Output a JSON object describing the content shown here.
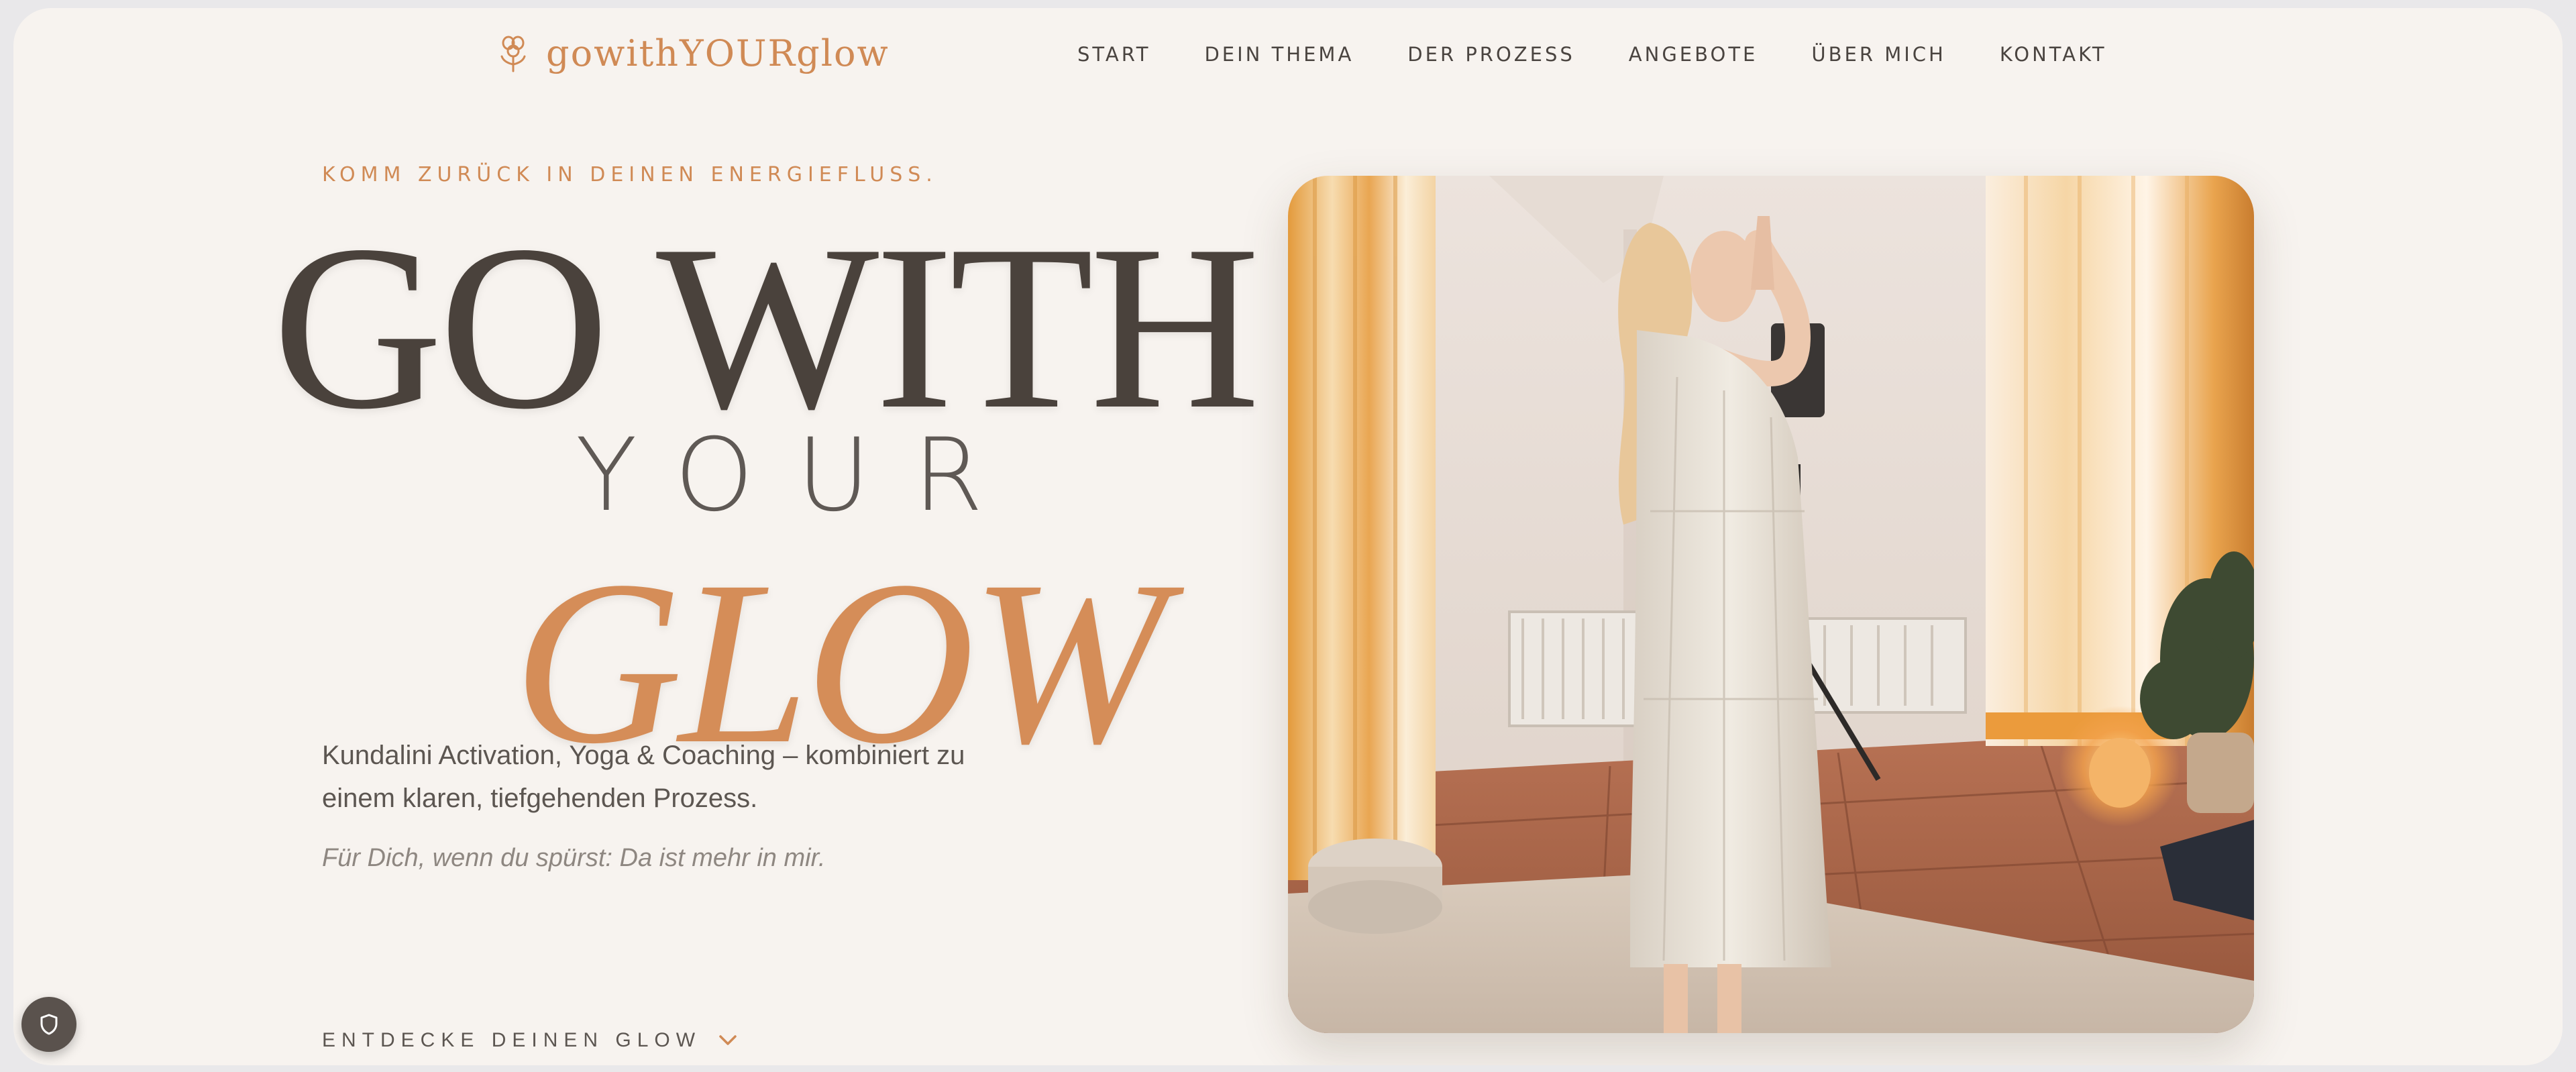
{
  "brand": {
    "name": "gowithYOURglow",
    "accent": "#d08a55",
    "dark": "#4a423c"
  },
  "nav": {
    "items": [
      "START",
      "DEIN THEMA",
      "DER PROZESS",
      "ANGEBOTE",
      "ÜBER MICH",
      "KONTAKT"
    ]
  },
  "hero": {
    "eyebrow": "KOMM ZURÜCK IN DEINEN ENERGIEFLUSS.",
    "line1": "GO WITH",
    "line2": "YOUR",
    "line3": "GLOW",
    "intro": "Kundalini Activation, Yoga & Coaching – kombiniert zu einem klaren, tiefgehenden Prozess.",
    "tagline": "Für Dich, wenn du spürst: Da ist mehr in mir.",
    "cta": "ENTDECKE DEINEN GLOW",
    "image_icon": "woman-praying-photo"
  },
  "privacy": {
    "icon": "shield-icon"
  }
}
